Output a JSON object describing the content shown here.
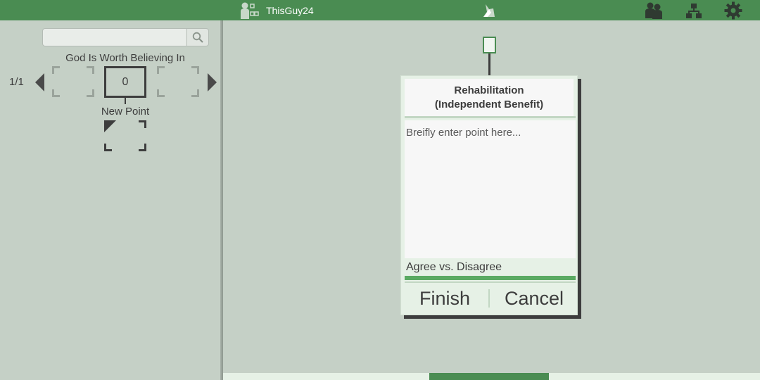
{
  "header": {
    "username": "ThisGuy24",
    "icons": {
      "profile": "user-profile-icon",
      "logo": "unicorn-logo-icon",
      "community": "people-icon",
      "hierarchy": "hierarchy-icon",
      "settings": "gear-icon"
    }
  },
  "sidebar": {
    "search": {
      "value": "",
      "placeholder": ""
    },
    "topic_title": "God Is Worth Believing In",
    "pager": "1/1",
    "current_node_value": "0",
    "new_point_label": "New Point"
  },
  "card": {
    "title_line1": "Rehabilitation",
    "title_line2": "(Independent Benefit)",
    "textarea_placeholder": "Breifly enter point here...",
    "agree_label": "Agree vs. Disagree",
    "agree_fraction": 1.0,
    "finish_label": "Finish",
    "cancel_label": "Cancel"
  },
  "colors": {
    "accent_green": "#4a8c52",
    "agree_bar": "#5aaa62",
    "background": "#c5d0c6",
    "card": "#e6f1e6"
  }
}
